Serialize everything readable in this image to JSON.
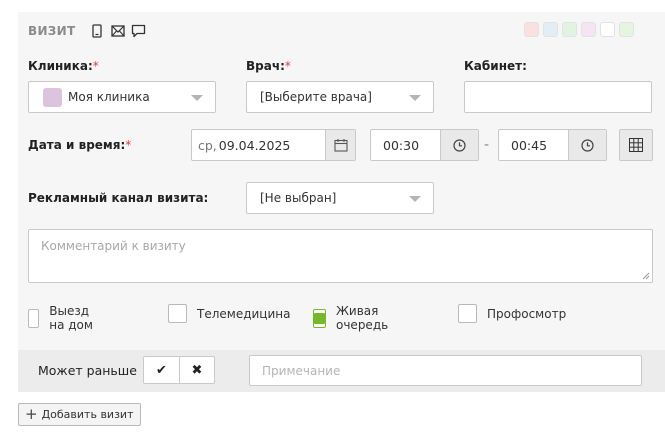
{
  "header": {
    "title": "ВИЗИТ",
    "icons": [
      "phone-icon",
      "mail-icon",
      "chat-icon"
    ],
    "swatch_colors": [
      "#fbe0e0",
      "#e3edf6",
      "#e2f3e3",
      "#f6e3f4",
      "#ffffff",
      "#e6f4e2"
    ]
  },
  "clinic": {
    "label": "Клиника:",
    "required": "*",
    "value": "Моя клиника",
    "swatch_color": "#dcc4de"
  },
  "doctor": {
    "label": "Врач:",
    "required": "*",
    "value": "[Выберите врача]"
  },
  "cabinet": {
    "label": "Кабинет:",
    "value": ""
  },
  "datetime": {
    "label": "Дата и время:",
    "required": "*",
    "weekday": "ср,",
    "date": "09.04.2025",
    "time_from": "00:30",
    "separator": "-",
    "time_to": "00:45"
  },
  "ad_channel": {
    "label": "Рекламный канал визита:",
    "value": "[Не выбран]"
  },
  "comment": {
    "placeholder": "Комментарий к визиту"
  },
  "checkboxes": [
    {
      "label": "Выезд на дом",
      "checked": false
    },
    {
      "label": "Телемедицина",
      "checked": false
    },
    {
      "label": "Живая очередь",
      "checked": true
    },
    {
      "label": "Профосмотр",
      "checked": false
    }
  ],
  "earlier": {
    "label": "Может раньше",
    "yes_icon": "✔",
    "no_icon": "✖",
    "note_placeholder": "Примечание"
  },
  "add_visit": {
    "icon": "+",
    "label": "Добавить визит"
  }
}
